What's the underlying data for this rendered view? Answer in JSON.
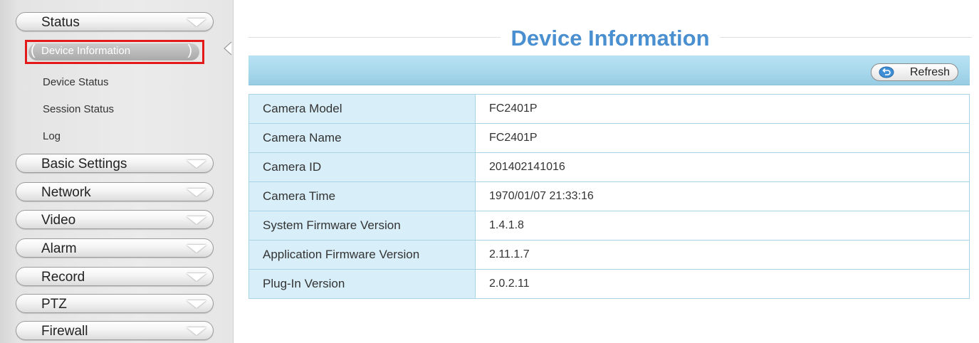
{
  "sidebar": {
    "menus": [
      {
        "label": "Status"
      },
      {
        "label": "Basic Settings"
      },
      {
        "label": "Network"
      },
      {
        "label": "Video"
      },
      {
        "label": "Alarm"
      },
      {
        "label": "Record"
      },
      {
        "label": "PTZ"
      },
      {
        "label": "Firewall"
      }
    ],
    "status_submenu": {
      "active": "Device Information",
      "items": [
        "Device Status",
        "Session Status",
        "Log"
      ]
    },
    "active_marker": {
      "left": "(",
      "right": ")"
    },
    "highlight_color": "#e21a1a"
  },
  "main": {
    "title": "Device Information",
    "title_color": "#4a8fd0",
    "refresh_label": "Refresh",
    "rows": [
      {
        "label": "Camera Model",
        "value": "FC2401P"
      },
      {
        "label": "Camera Name",
        "value": "FC2401P"
      },
      {
        "label": "Camera ID",
        "value": "201402141016"
      },
      {
        "label": "Camera Time",
        "value": "1970/01/07 21:33:16"
      },
      {
        "label": "System Firmware Version",
        "value": "1.4.1.8"
      },
      {
        "label": "Application Firmware Version",
        "value": "2.11.1.7"
      },
      {
        "label": "Plug-In Version",
        "value": "2.0.2.11"
      }
    ]
  },
  "icons": {
    "menu_expand": "chevron-down-icon",
    "refresh": "refresh-icon"
  }
}
